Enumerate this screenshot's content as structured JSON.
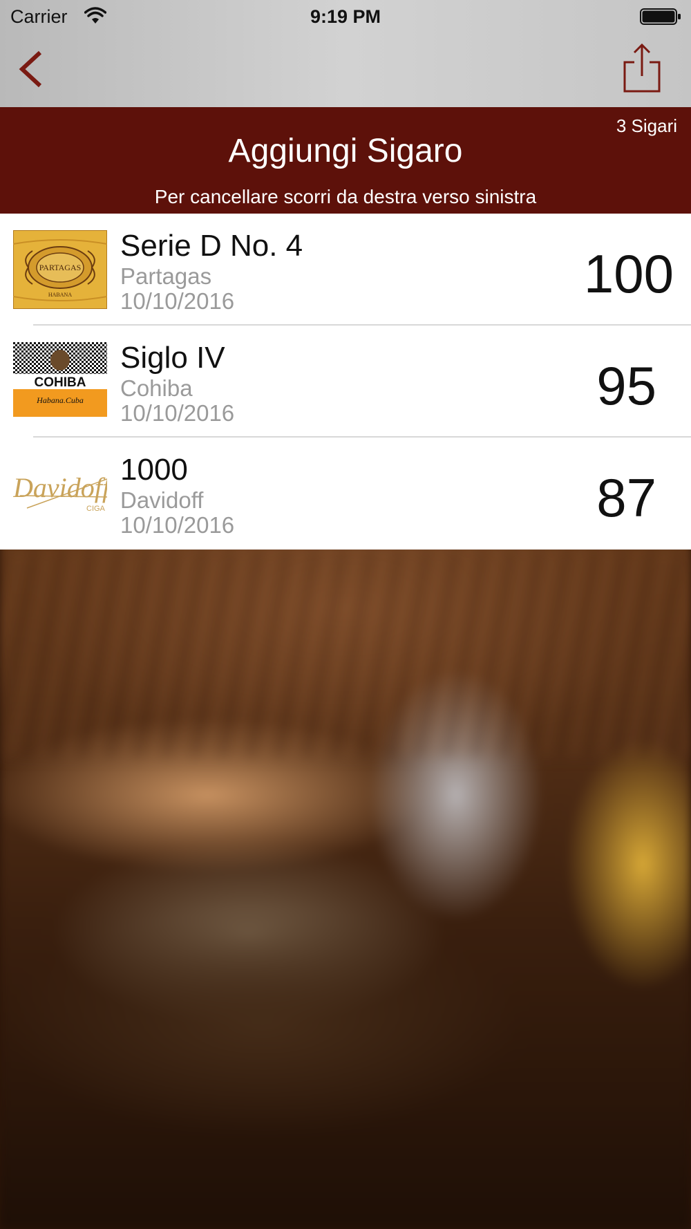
{
  "status_bar": {
    "carrier": "Carrier",
    "time": "9:19 PM"
  },
  "nav": {
    "back_icon": "chevron-left-icon",
    "share_icon": "share-icon",
    "accent_color": "#7a1a12"
  },
  "header": {
    "count": "3 Sigari",
    "title": "Aggiungi Sigaro",
    "hint": "Per cancellare scorri da destra verso sinistra",
    "background": "#5d110a"
  },
  "cigars": [
    {
      "name": "Serie D No. 4",
      "brand": "Partagas",
      "date": "10/10/2016",
      "score": "100",
      "logo_text": "PARTAGAS",
      "logo_subtext": "HABANA"
    },
    {
      "name": "Siglo IV",
      "brand": "Cohiba",
      "date": "10/10/2016",
      "score": "95",
      "logo_text": "COHIBA",
      "logo_subtext": "Habana.Cuba"
    },
    {
      "name": "1000",
      "brand": "Davidoff",
      "date": "10/10/2016",
      "score": "87",
      "logo_text": "Davidoff",
      "logo_subtext": "CIGA"
    }
  ]
}
